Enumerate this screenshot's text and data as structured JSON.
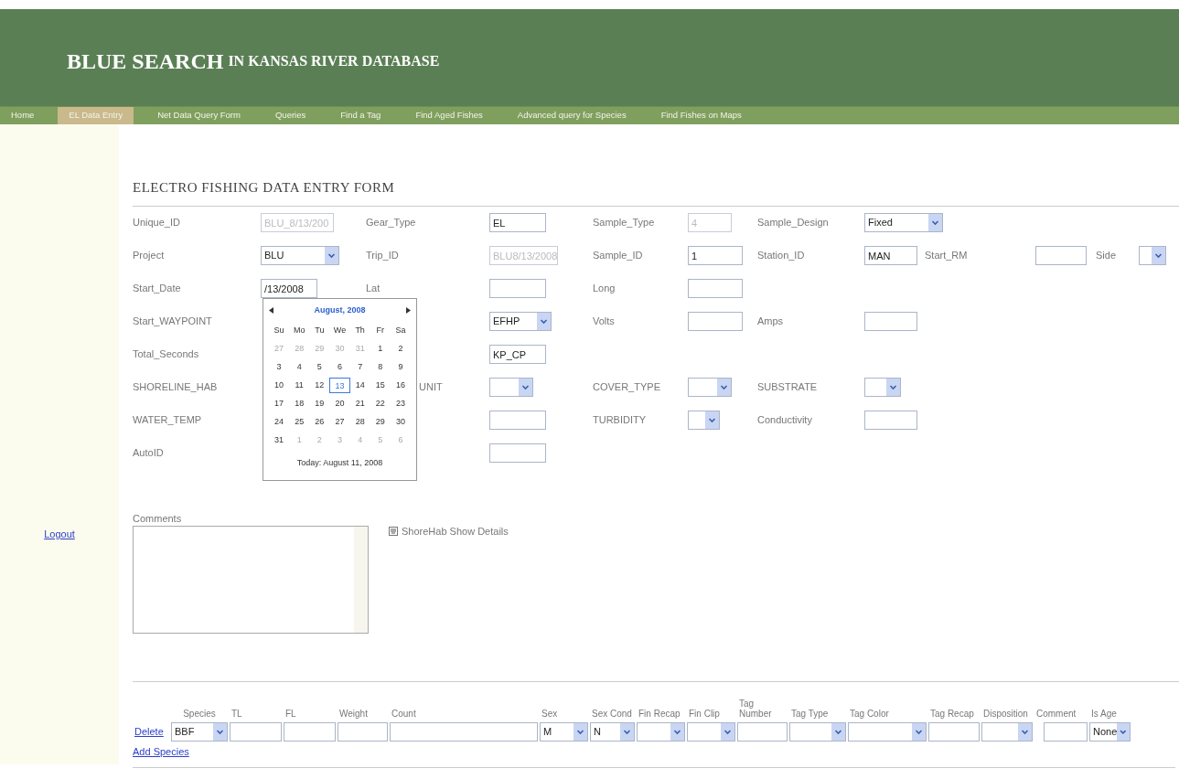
{
  "header": {
    "title": "BLUE SEARCH",
    "subtitle": "IN KANSAS RIVER DATABASE"
  },
  "nav": [
    {
      "label": "Home",
      "selected": false
    },
    {
      "label": "EL Data Entry",
      "selected": true
    },
    {
      "label": "Net Data Query Form",
      "selected": false
    },
    {
      "label": "Queries",
      "selected": false
    },
    {
      "label": "Find a Tag",
      "selected": false
    },
    {
      "label": "Find Aged Fishes",
      "selected": false
    },
    {
      "label": "Advanced query for Species",
      "selected": false
    },
    {
      "label": "Find Fishes on Maps",
      "selected": false
    }
  ],
  "sidebar": {
    "logout": "Logout"
  },
  "form": {
    "title": "ELECTRO FISHING DATA ENTRY FORM",
    "rows": [
      [
        {
          "label": "Unique_ID",
          "field": {
            "kind": "text",
            "value": "BLU_8/13/200",
            "disabled": true
          }
        },
        {
          "label": "Gear_Type",
          "field": {
            "kind": "text",
            "value": "EL",
            "disabled": false
          }
        },
        {
          "label": "Sample_Type",
          "field": {
            "kind": "text",
            "value": "4",
            "disabled": true
          }
        },
        {
          "label": "Sample_Design",
          "field": {
            "kind": "select",
            "value": "Fixed"
          }
        }
      ],
      [
        {
          "label": "Project",
          "field": {
            "kind": "select",
            "value": "BLU"
          }
        },
        {
          "label": "Trip_ID",
          "field": {
            "kind": "text",
            "value": "BLU8/13/2008",
            "disabled": true
          }
        },
        {
          "label": "Sample_ID",
          "field": {
            "kind": "text",
            "value": "1",
            "disabled": false
          }
        },
        {
          "label": "Station_ID",
          "field": {
            "kind": "text",
            "value": "MAN",
            "disabled": false
          }
        },
        {
          "label": "Start_RM",
          "field": {
            "kind": "text",
            "disabled": false
          }
        },
        {
          "label": "Side",
          "field": {
            "kind": "select"
          }
        }
      ],
      [
        {
          "label": "Start_Date",
          "field": {
            "kind": "text",
            "value": "/13/2008",
            "disabled": false
          }
        },
        {
          "label": "Lat",
          "field": {
            "kind": "text",
            "disabled": false
          }
        },
        {
          "label": "Long",
          "field": {
            "kind": "text",
            "disabled": false
          }
        }
      ],
      [
        {
          "label": "Start_WAYPOINT"
        },
        {
          "field": {
            "kind": "select",
            "value": "EFHP"
          }
        },
        {
          "label": "Volts",
          "field": {
            "kind": "text",
            "disabled": false
          }
        },
        {
          "label": "Amps",
          "field": {
            "kind": "text",
            "disabled": false
          }
        }
      ],
      [
        {
          "label": "Total_Seconds"
        },
        {
          "field": {
            "kind": "text",
            "value": "KP_CP",
            "disabled": false
          }
        }
      ],
      [
        {
          "label": "SHORELINE_HAB"
        },
        {
          "label": "UNIT",
          "field": {
            "kind": "select"
          }
        },
        {
          "label": "COVER_TYPE",
          "field": {
            "kind": "select"
          }
        },
        {
          "label": "SUBSTRATE",
          "field": {
            "kind": "select"
          }
        }
      ],
      [
        {
          "label": "WATER_TEMP"
        },
        {
          "field": {
            "kind": "text",
            "disabled": false
          }
        },
        {
          "label": "TURBIDITY",
          "field": {
            "kind": "select"
          }
        },
        {
          "label": "Conductivity",
          "field": {
            "kind": "text",
            "disabled": false
          }
        }
      ],
      [
        {
          "label": "AutoID"
        },
        {
          "field": {
            "kind": "text",
            "disabled": false
          }
        }
      ]
    ]
  },
  "calendar": {
    "title": "August, 2008",
    "weekdays": [
      "Su",
      "Mo",
      "Tu",
      "We",
      "Th",
      "Fr",
      "Sa"
    ],
    "weeks": [
      [
        {
          "day": "27",
          "other_month": true,
          "selected": false
        },
        {
          "day": "28",
          "other_month": true,
          "selected": false
        },
        {
          "day": "29",
          "other_month": true,
          "selected": false
        },
        {
          "day": "30",
          "other_month": true,
          "selected": false
        },
        {
          "day": "31",
          "other_month": true,
          "selected": false
        },
        {
          "day": "1",
          "other_month": false,
          "selected": false
        },
        {
          "day": "2",
          "other_month": false,
          "selected": false
        }
      ],
      [
        {
          "day": "3",
          "other_month": false,
          "selected": false
        },
        {
          "day": "4",
          "other_month": false,
          "selected": false
        },
        {
          "day": "5",
          "other_month": false,
          "selected": false
        },
        {
          "day": "6",
          "other_month": false,
          "selected": false
        },
        {
          "day": "7",
          "other_month": false,
          "selected": false
        },
        {
          "day": "8",
          "other_month": false,
          "selected": false
        },
        {
          "day": "9",
          "other_month": false,
          "selected": false
        }
      ],
      [
        {
          "day": "10",
          "other_month": false,
          "selected": false
        },
        {
          "day": "11",
          "other_month": false,
          "selected": false
        },
        {
          "day": "12",
          "other_month": false,
          "selected": false
        },
        {
          "day": "13",
          "other_month": false,
          "selected": true
        },
        {
          "day": "14",
          "other_month": false,
          "selected": false
        },
        {
          "day": "15",
          "other_month": false,
          "selected": false
        },
        {
          "day": "16",
          "other_month": false,
          "selected": false
        }
      ],
      [
        {
          "day": "17",
          "other_month": false,
          "selected": false
        },
        {
          "day": "18",
          "other_month": false,
          "selected": false
        },
        {
          "day": "19",
          "other_month": false,
          "selected": false
        },
        {
          "day": "20",
          "other_month": false,
          "selected": false
        },
        {
          "day": "21",
          "other_month": false,
          "selected": false
        },
        {
          "day": "22",
          "other_month": false,
          "selected": false
        },
        {
          "day": "23",
          "other_month": false,
          "selected": false
        }
      ],
      [
        {
          "day": "24",
          "other_month": false,
          "selected": false
        },
        {
          "day": "25",
          "other_month": false,
          "selected": false
        },
        {
          "day": "26",
          "other_month": false,
          "selected": false
        },
        {
          "day": "27",
          "other_month": false,
          "selected": false
        },
        {
          "day": "28",
          "other_month": false,
          "selected": false
        },
        {
          "day": "29",
          "other_month": false,
          "selected": false
        },
        {
          "day": "30",
          "other_month": false,
          "selected": false
        }
      ],
      [
        {
          "day": "31",
          "other_month": false,
          "selected": false
        },
        {
          "day": "1",
          "other_month": true,
          "selected": false
        },
        {
          "day": "2",
          "other_month": true,
          "selected": false
        },
        {
          "day": "3",
          "other_month": true,
          "selected": false
        },
        {
          "day": "4",
          "other_month": true,
          "selected": false
        },
        {
          "day": "5",
          "other_month": true,
          "selected": false
        },
        {
          "day": "6",
          "other_month": true,
          "selected": false
        }
      ]
    ],
    "today": "Today: August 11, 2008"
  },
  "comments": {
    "label": "Comments"
  },
  "shorehab": {
    "label": "ShoreHab Show Details"
  },
  "species_table": {
    "columns": [
      "",
      "Species",
      "TL",
      "FL",
      "Weight",
      "Count",
      "Sex",
      "Sex Cond",
      "Fin Recap",
      "Fin Clip",
      "Tag Number",
      "Tag Type",
      "Tag Color",
      "Tag Recap",
      "Disposition",
      "Comment",
      "Is Age"
    ],
    "rows": [
      {
        "cells": [
          {
            "kind": "link",
            "value": "Delete"
          },
          {
            "kind": "select",
            "value": "BBF"
          },
          {
            "kind": "text"
          },
          {
            "kind": "text"
          },
          {
            "kind": "text"
          },
          {
            "kind": "text"
          },
          {
            "kind": "select",
            "value": "M"
          },
          {
            "kind": "select",
            "value": "N"
          },
          {
            "kind": "select"
          },
          {
            "kind": "select"
          },
          {
            "kind": "text"
          },
          {
            "kind": "select"
          },
          {
            "kind": "select"
          },
          {
            "kind": "text"
          },
          {
            "kind": "select"
          },
          {
            "kind": "text"
          },
          {
            "kind": "select",
            "value": "None"
          }
        ]
      }
    ],
    "add": "Add Species"
  }
}
